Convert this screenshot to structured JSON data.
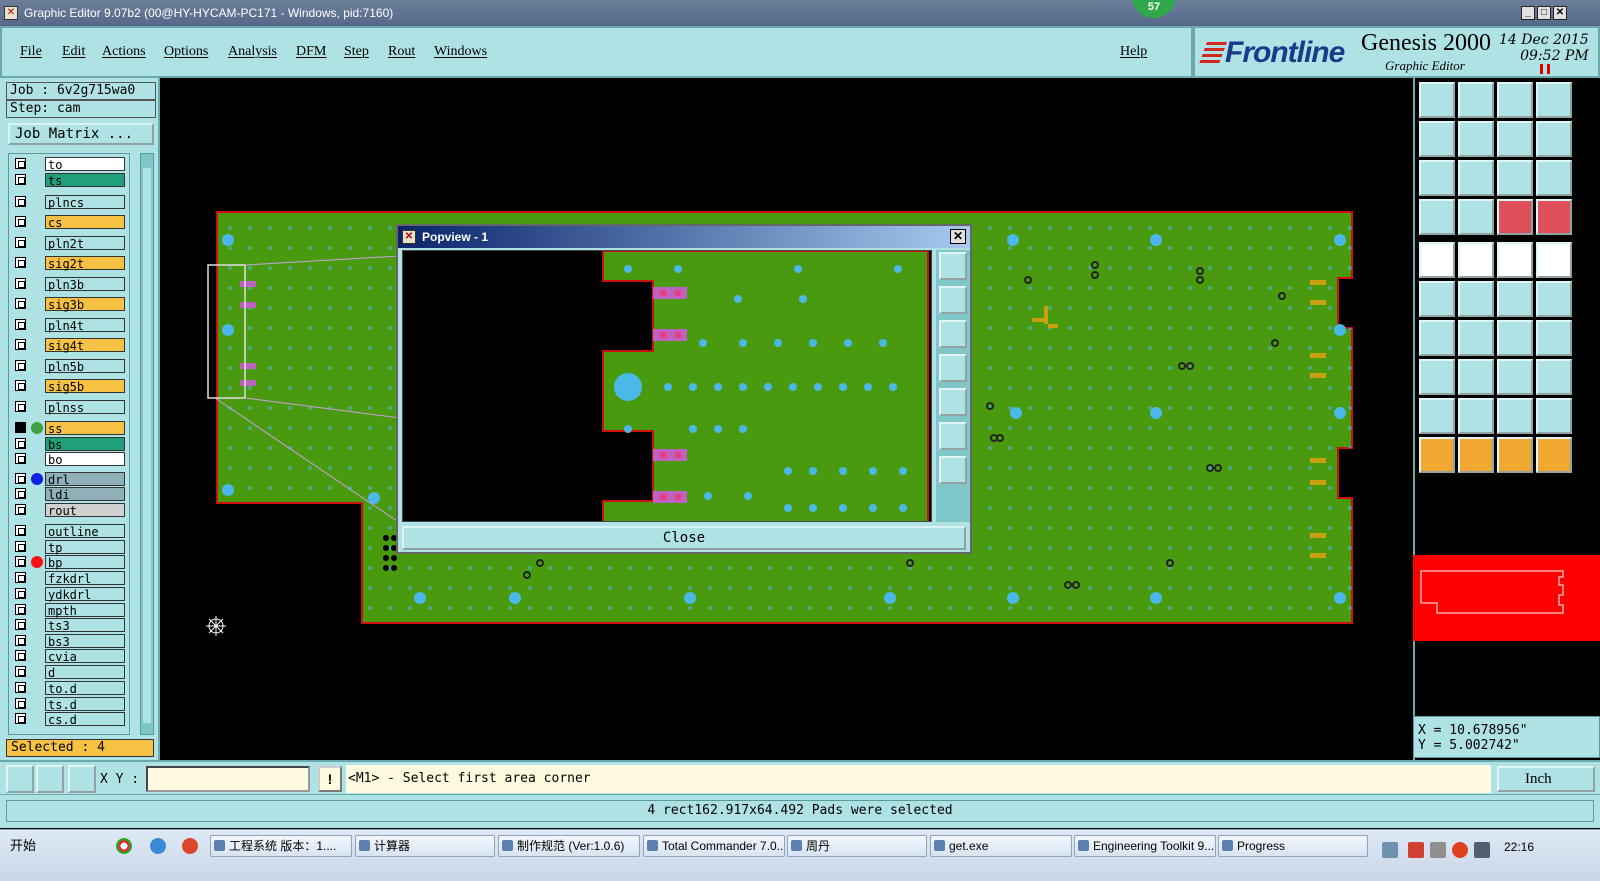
{
  "window": {
    "title": "Graphic Editor 9.07b2 (00@HY-HYCAM-PC171 - Windows, pid:7160)",
    "badge": "57",
    "minimize": "_",
    "restore": "□",
    "close": "✕"
  },
  "menu": {
    "items": [
      "File",
      "Edit",
      "Actions",
      "Options",
      "Analysis",
      "DFM",
      "Step",
      "Rout",
      "Windows"
    ],
    "help": "Help"
  },
  "brand": {
    "logo": "Frontline",
    "product": "Genesis 2000",
    "subtitle": "Graphic Editor",
    "date": "14 Dec 2015",
    "time": "09:52 PM"
  },
  "job": {
    "job_label": "Job : 6v2g715wa0",
    "step_label": "Step: cam",
    "matrix_button": "Job Matrix ...",
    "selected": "Selected : 4"
  },
  "layers": [
    {
      "name": "to",
      "color": "#ffffff"
    },
    {
      "name": "ts",
      "color": "#1fa07a"
    },
    {
      "name": "plncs",
      "color": "#aee2e4"
    },
    {
      "name": "cs",
      "color": "#f7c244"
    },
    {
      "name": "pln2t",
      "color": "#aee2e4"
    },
    {
      "name": "sig2t",
      "color": "#f7c244"
    },
    {
      "name": "pln3b",
      "color": "#aee2e4"
    },
    {
      "name": "sig3b",
      "color": "#f7c244"
    },
    {
      "name": "pln4t",
      "color": "#aee2e4"
    },
    {
      "name": "sig4t",
      "color": "#f7c244"
    },
    {
      "name": "pln5b",
      "color": "#aee2e4"
    },
    {
      "name": "sig5b",
      "color": "#f7c244"
    },
    {
      "name": "plnss",
      "color": "#aee2e4"
    },
    {
      "name": "ss",
      "color": "#f7c244",
      "active": true,
      "dotColor": "#3fa040"
    },
    {
      "name": "bs",
      "color": "#1fa07a"
    },
    {
      "name": "bo",
      "color": "#ffffff"
    },
    {
      "name": "drl",
      "color": "#8fb0b8",
      "dotColor": "#1020e0"
    },
    {
      "name": "ldi",
      "color": "#8fb0b8"
    },
    {
      "name": "rout",
      "color": "#d0d0d0"
    },
    {
      "name": "outline",
      "color": "#aee2e4"
    },
    {
      "name": "tp",
      "color": "#aee2e4"
    },
    {
      "name": "bp",
      "color": "#aee2e4",
      "dotColor": "#ff1010"
    },
    {
      "name": "fzkdrl",
      "color": "#aee2e4"
    },
    {
      "name": "ydkdrl",
      "color": "#aee2e4"
    },
    {
      "name": "mpth",
      "color": "#aee2e4"
    },
    {
      "name": "ts3",
      "color": "#aee2e4"
    },
    {
      "name": "bs3",
      "color": "#aee2e4"
    },
    {
      "name": "cvia",
      "color": "#aee2e4"
    },
    {
      "name": "d",
      "color": "#aee2e4"
    },
    {
      "name": "to.d",
      "color": "#aee2e4"
    },
    {
      "name": "ts.d",
      "color": "#aee2e4"
    },
    {
      "name": "cs.d",
      "color": "#aee2e4"
    }
  ],
  "popview": {
    "title": "Popview - 1",
    "close_button": "Close"
  },
  "coords": {
    "x": "X = 10.678956\"",
    "y": "Y = 5.002742\""
  },
  "input": {
    "xy_label": "X Y :",
    "xy_value": "",
    "excl": "!",
    "prompt": "<M1> - Select first area corner",
    "unit": "Inch"
  },
  "status": {
    "message": "4 rect162.917x64.492 Pads were selected"
  },
  "taskbar": {
    "start": "开始",
    "tasks": [
      {
        "label": "工程系统  版本：1...."
      },
      {
        "label": "计算器"
      },
      {
        "label": "制作规范 (Ver:1.0.6)"
      },
      {
        "label": "Total Commander 7.0..."
      },
      {
        "label": "周丹"
      },
      {
        "label": "get.exe"
      },
      {
        "label": "Engineering Toolkit 9...."
      },
      {
        "label": "Progress"
      }
    ],
    "clock": "22:16"
  },
  "colors": {
    "panel": "#aee2e4",
    "board": "#4a9a10",
    "pad": "#4ab8e8",
    "highlight": "#f7c244",
    "outline": "#cc1010"
  }
}
